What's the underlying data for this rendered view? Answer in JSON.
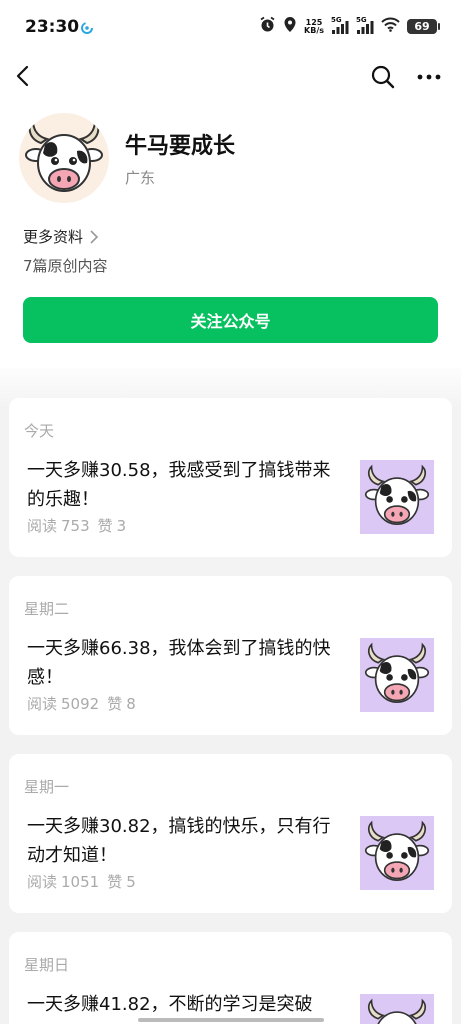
{
  "status_bar": {
    "time": "23:30",
    "net_speed_value": "125",
    "net_speed_unit": "KB/s",
    "signal1_tag": "5G",
    "signal2_tag": "5G",
    "battery": "69"
  },
  "nav": {
    "back_icon": "chevron-left-icon",
    "search_icon": "search-icon",
    "more_icon": "more-dots-icon"
  },
  "profile": {
    "name": "牛马要成长",
    "region": "广东",
    "more_info_label": "更多资料",
    "original_count": "7篇原创内容",
    "follow_label": "关注公众号"
  },
  "colors": {
    "accent": "#07c160",
    "thumb_bg": "#dcc8f5"
  },
  "articles": [
    {
      "day": "今天",
      "title": "一天多赚30.58，我感受到了搞钱带来的乐趣！",
      "reads_label": "阅读",
      "reads": "753",
      "likes_label": "赞",
      "likes": "3"
    },
    {
      "day": "星期二",
      "title": "一天多赚66.38，我体会到了搞钱的快感！",
      "reads_label": "阅读",
      "reads": "5092",
      "likes_label": "赞",
      "likes": "8"
    },
    {
      "day": "星期一",
      "title": "一天多赚30.82，搞钱的快乐，只有行动才知道！",
      "reads_label": "阅读",
      "reads": "1051",
      "likes_label": "赞",
      "likes": "5"
    },
    {
      "day": "星期日",
      "title": "一天多赚41.82，不断的学习是突破",
      "reads_label": "",
      "reads": "",
      "likes_label": "",
      "likes": ""
    }
  ]
}
